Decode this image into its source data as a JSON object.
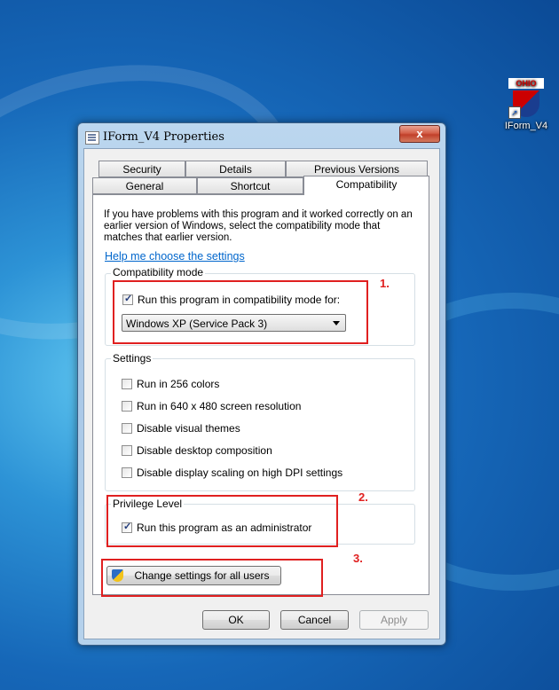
{
  "desktop": {
    "icon_label": "IForm_V4",
    "icon_banner": "OHIO"
  },
  "window": {
    "title": "IForm_V4 Properties",
    "close_glyph": "x"
  },
  "tabs_row1": [
    "Security",
    "Details",
    "Previous Versions"
  ],
  "tabs_row2": [
    "General",
    "Shortcut",
    "Compatibility"
  ],
  "active_tab": "Compatibility",
  "description": "If you have problems with this program and it worked correctly on an earlier version of Windows, select the compatibility mode that matches that earlier version.",
  "help_link": "Help me choose the settings",
  "compat_mode": {
    "label": "Compatibility mode",
    "checkbox_label": "Run this program in compatibility mode for:",
    "checked": true,
    "selected": "Windows XP (Service Pack 3)"
  },
  "settings": {
    "label": "Settings",
    "items": [
      {
        "label": "Run in 256 colors",
        "checked": false
      },
      {
        "label": "Run in 640 x 480 screen resolution",
        "checked": false
      },
      {
        "label": "Disable visual themes",
        "checked": false
      },
      {
        "label": "Disable desktop composition",
        "checked": false
      },
      {
        "label": "Disable display scaling on high DPI settings",
        "checked": false
      }
    ]
  },
  "privilege": {
    "label": "Privilege Level",
    "checkbox_label": "Run this program as an administrator",
    "checked": true
  },
  "change_all_button": "Change settings for all users",
  "buttons": {
    "ok": "OK",
    "cancel": "Cancel",
    "apply": "Apply"
  },
  "annotations": [
    "1.",
    "2.",
    "3."
  ],
  "colors": {
    "annotation_red": "#e02020",
    "link_blue": "#0066cc"
  }
}
